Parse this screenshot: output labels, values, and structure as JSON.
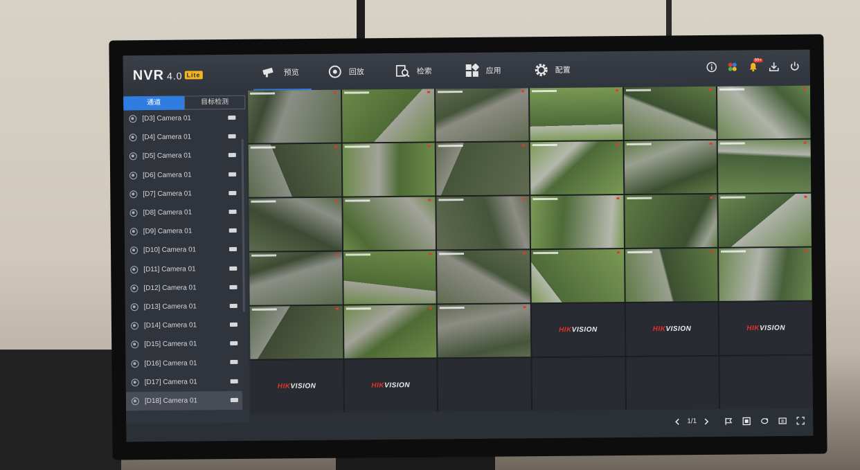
{
  "app": {
    "logo": "NVR",
    "version": "4.0",
    "edition": "Lite"
  },
  "nav": [
    {
      "label": "预览",
      "icon": "camera-icon",
      "active": true
    },
    {
      "label": "回放",
      "icon": "playback-icon",
      "active": false
    },
    {
      "label": "检索",
      "icon": "search-icon",
      "active": false
    },
    {
      "label": "应用",
      "icon": "apps-icon",
      "active": false
    },
    {
      "label": "配置",
      "icon": "gear-icon",
      "active": false
    }
  ],
  "top_icons": [
    "info-icon",
    "color-palette-icon",
    "bell-icon",
    "download-icon",
    "power-icon"
  ],
  "notification_badge": "99+",
  "sidebar": {
    "tabs": [
      {
        "label": "通道",
        "active": true
      },
      {
        "label": "目标检测",
        "active": false
      }
    ],
    "cameras": [
      "[D3] Camera 01",
      "[D4] Camera 01",
      "[D5] Camera 01",
      "[D6] Camera 01",
      "[D7] Camera 01",
      "[D8] Camera 01",
      "[D9] Camera 01",
      "[D10] Camera 01",
      "[D11] Camera 01",
      "[D12] Camera 01",
      "[D13] Camera 01",
      "[D14] Camera 01",
      "[D15] Camera 01",
      "[D16] Camera 01",
      "[D17] Camera 01",
      "[D18] Camera 01"
    ],
    "selected_index": 15
  },
  "grid": {
    "columns": 6,
    "rows": 6,
    "live_feeds": 27,
    "brand_red": "HIK",
    "brand_white": "VISION",
    "brand_tiles": [
      27,
      28,
      29,
      30,
      31
    ]
  },
  "pager": {
    "page": "1/1",
    "prev_icon": "chevron-left-icon",
    "next_icon": "chevron-right-icon"
  },
  "bottom_icons": [
    "flag-icon",
    "fullscreen-toggle-icon",
    "cycle-icon",
    "layout-icon",
    "expand-icon"
  ],
  "colors": {
    "accent": "#2f7de1",
    "brand_red": "#e2332a",
    "panel": "#30343c"
  }
}
